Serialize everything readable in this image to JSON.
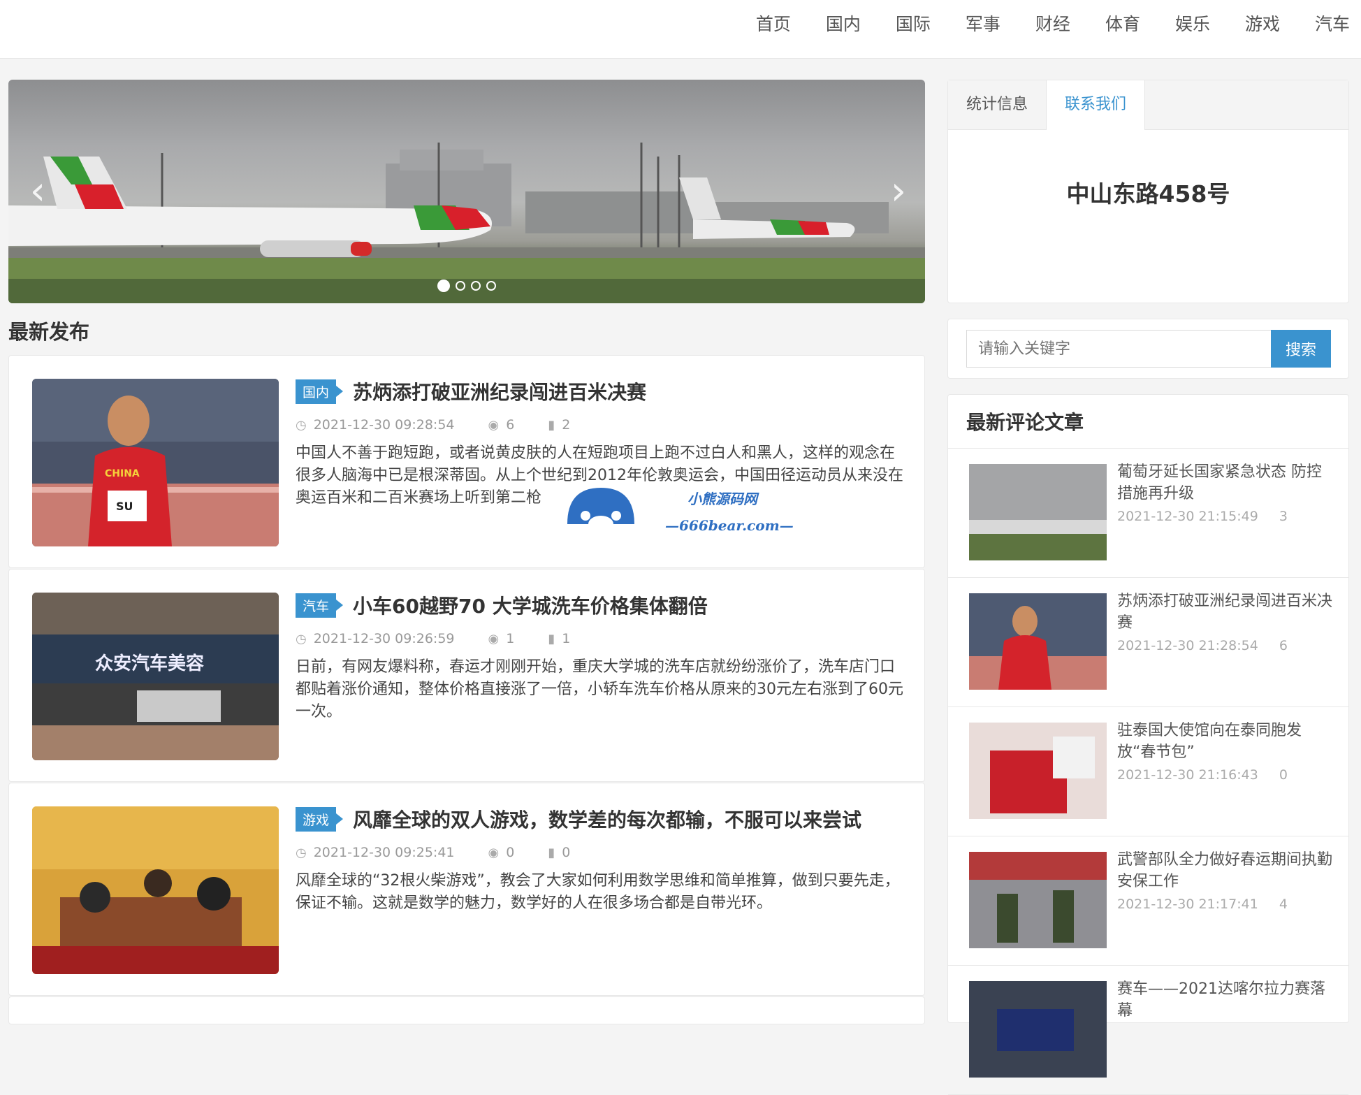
{
  "nav": {
    "items": [
      "首页",
      "国内",
      "国际",
      "军事",
      "财经",
      "体育",
      "娱乐",
      "游戏",
      "汽车"
    ]
  },
  "slider": {
    "dots": 4,
    "active_dot": 0
  },
  "section": {
    "title": "最新发布"
  },
  "articles": [
    {
      "tag": "国内",
      "title": "苏炳添打破亚洲纪录闯进百米决赛",
      "date": "2021-12-30 09:28:54",
      "views": "6",
      "comments": "2",
      "desc": "中国人不善于跑短跑，或者说黄皮肤的人在短跑项目上跑不过白人和黑人，这样的观念在很多人脑海中已是根深蒂固。从上个世纪到2012年伦敦奥运会，中国田径运动员从来没在奥运百米和二百米赛场上听到第二枪"
    },
    {
      "tag": "汽车",
      "title": "小车60越野70 大学城洗车价格集体翻倍",
      "date": "2021-12-30 09:26:59",
      "views": "1",
      "comments": "1",
      "desc": "日前，有网友爆料称，春运才刚刚开始，重庆大学城的洗车店就纷纷涨价了，洗车店门口都贴着涨价通知，整体价格直接涨了一倍，小轿车洗车价格从原来的30元左右涨到了60元一次。"
    },
    {
      "tag": "游戏",
      "title": "风靡全球的双人游戏，数学差的每次都输，不服可以来尝试",
      "date": "2021-12-30 09:25:41",
      "views": "0",
      "comments": "0",
      "desc": "风靡全球的“32根火柴游戏”，教会了大家如何利用数学思维和简单推算，做到只要先走，保证不输。这就是数学的魅力，数学好的人在很多场合都是自带光环。"
    }
  ],
  "sidebar": {
    "tabs": [
      "统计信息",
      "联系我们"
    ],
    "active_tab": 1,
    "contact_text": "中山东路458号",
    "search": {
      "placeholder": "请输入关键字",
      "button": "搜索"
    },
    "comments_title": "最新评论文章",
    "comments": [
      {
        "title": "葡萄牙延长国家紧急状态 防控措施再升级",
        "date": "2021-12-30 21:15:49",
        "views": "3"
      },
      {
        "title": "苏炳添打破亚洲纪录闯进百米决赛",
        "date": "2021-12-30 21:28:54",
        "views": "6"
      },
      {
        "title": "驻泰国大使馆向在泰同胞发放“春节包”",
        "date": "2021-12-30 21:16:43",
        "views": "0"
      },
      {
        "title": "武警部队全力做好春运期间执勤安保工作",
        "date": "2021-12-30 21:17:41",
        "views": "4"
      },
      {
        "title": "赛车——2021达喀尔拉力赛落幕",
        "date": "",
        "views": ""
      }
    ]
  },
  "watermark": {
    "line1": "小熊源码网",
    "line2": "—666bear.com—"
  },
  "colors": {
    "accent": "#3a93cf",
    "text": "#333333",
    "muted": "#999999"
  }
}
